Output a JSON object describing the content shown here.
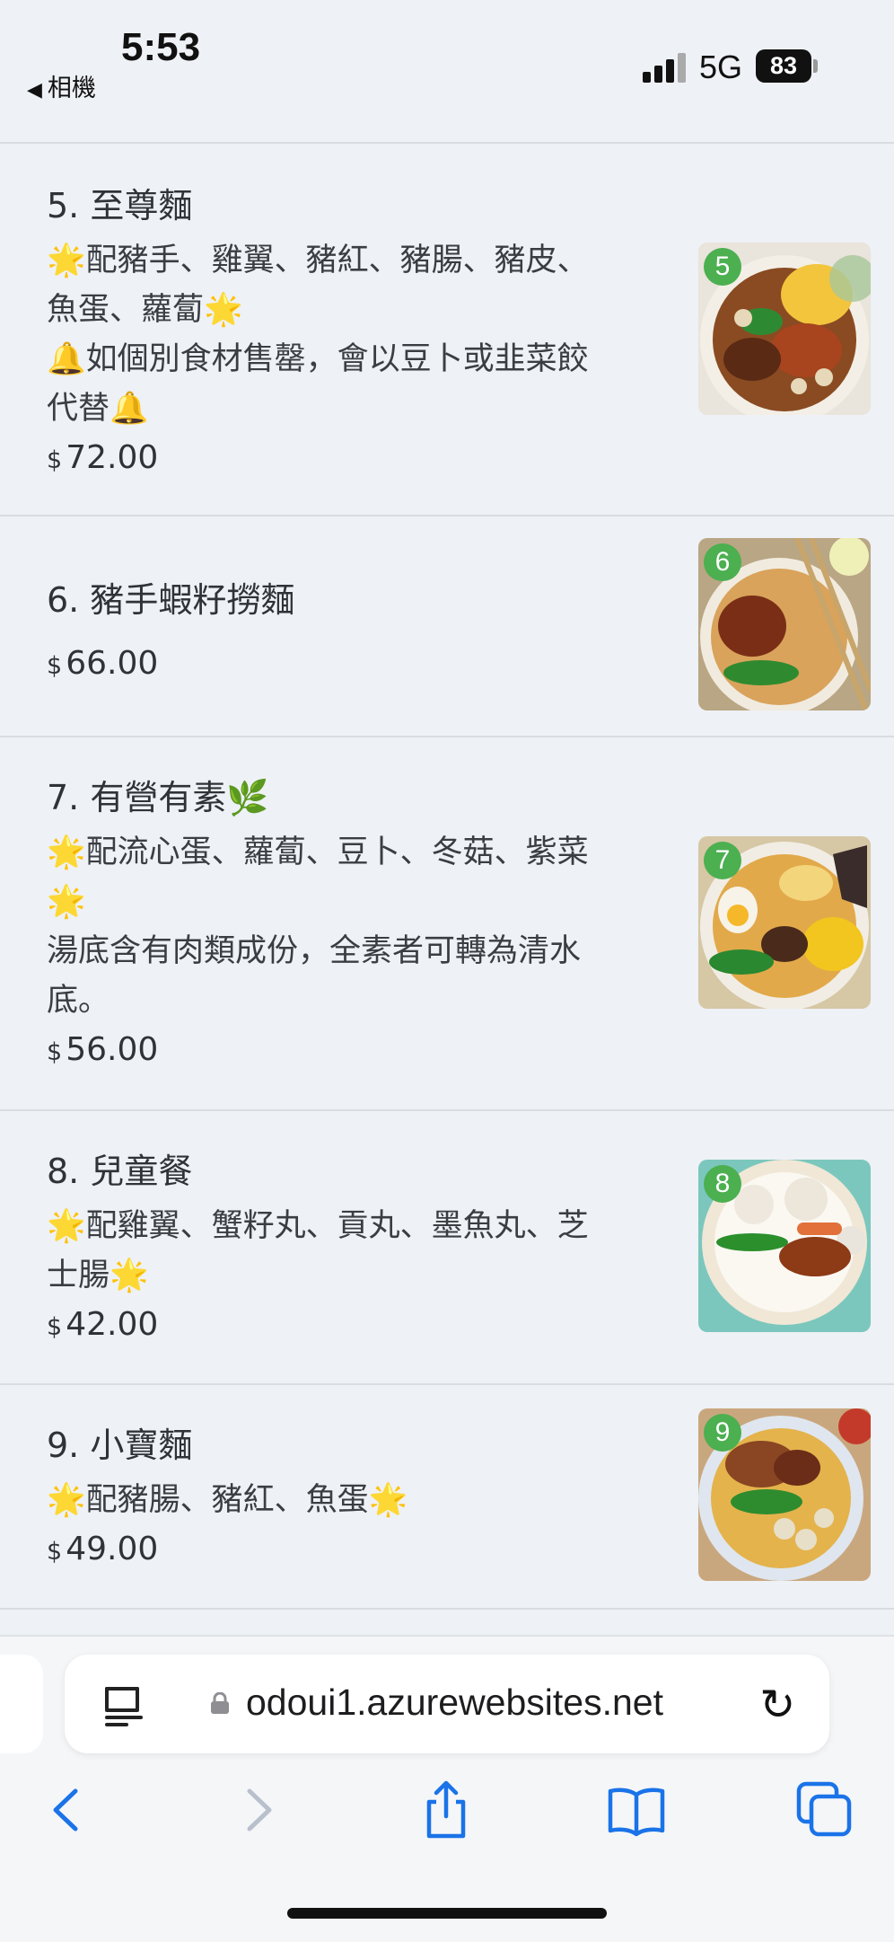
{
  "status": {
    "time": "5:53",
    "back_app": "相機",
    "network": "5G",
    "battery": "83"
  },
  "menu_items": [
    {
      "number": "5",
      "name": "5. 至尊麵",
      "desc_lines": [
        "🌟配豬手、雞翼、豬紅、豬腸、豬皮、",
        "魚蛋、蘿蔔🌟",
        "🔔如個別食材售罄，會以豆卜或韭菜餃",
        "代替🔔"
      ],
      "currency": "$",
      "price": "72.00"
    },
    {
      "number": "6",
      "name": "6. 豬手蝦籽撈麵",
      "desc_lines": [],
      "currency": "$",
      "price": "66.00"
    },
    {
      "number": "7",
      "name": "7. 有營有素🌿",
      "desc_lines": [
        "🌟配流心蛋、蘿蔔、豆卜、冬菇、紫菜",
        "🌟",
        "湯底含有肉類成份，全素者可轉為清水",
        "底。"
      ],
      "currency": "$",
      "price": "56.00"
    },
    {
      "number": "8",
      "name": "8. 兒童餐",
      "desc_lines": [
        "🌟配雞翼、蟹籽丸、貢丸、墨魚丸、芝",
        "士腸🌟"
      ],
      "currency": "$",
      "price": "42.00"
    },
    {
      "number": "9",
      "name": "9. 小寶麵",
      "desc_lines": [
        "🌟配豬腸、豬紅、魚蛋🌟"
      ],
      "currency": "$",
      "price": "49.00"
    }
  ],
  "browser": {
    "url": "odoui1.azurewebsites.net"
  },
  "colors": {
    "background": "#eef1f5",
    "accent_blue": "#1a73e8",
    "badge_green": "#4caf50"
  }
}
